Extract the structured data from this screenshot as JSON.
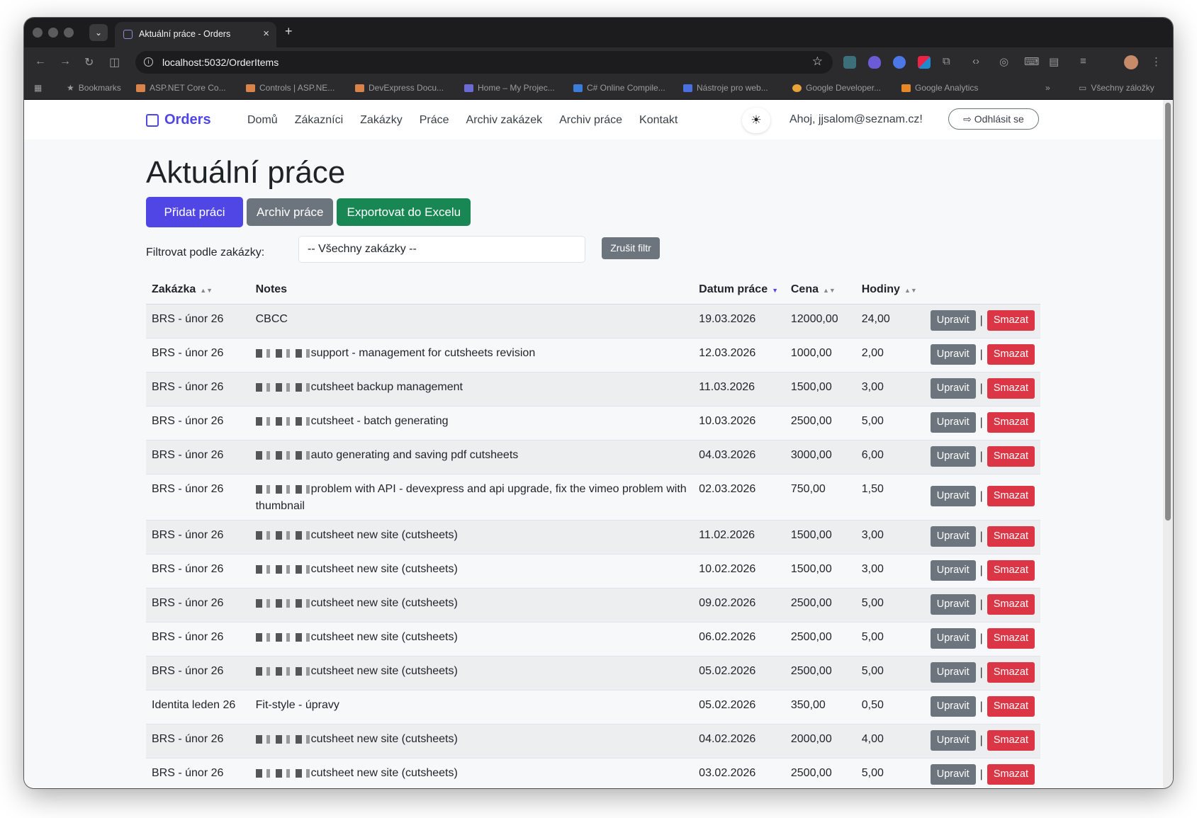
{
  "browser": {
    "tab_title": "Aktuální práce - Orders",
    "url": "localhost:5032/OrderItems",
    "bookmarks": [
      "Bookmarks",
      "ASP.NET Core Co...",
      "Controls | ASP.NE...",
      "DevExpress Docu...",
      "Home – My Projec...",
      "C# Online Compile...",
      "Nástroje pro web...",
      "Google Developer...",
      "Google Analytics"
    ],
    "bookmarks_overflow": "»",
    "all_bookmarks": "Všechny záložky"
  },
  "navbar": {
    "brand": "Orders",
    "links": [
      "Domů",
      "Zákazníci",
      "Zakázky",
      "Práce",
      "Archiv zakázek",
      "Archiv práce",
      "Kontakt"
    ],
    "greeting": "Ahoj, jjsalom@seznam.cz!",
    "logout": "Odhlásit se"
  },
  "page": {
    "title": "Aktuální práce",
    "add_button": "Přidat práci",
    "archive_button": "Archiv práce",
    "export_button": "Exportovat do Excelu",
    "filter_label": "Filtrovat podle zakázky:",
    "filter_value": "-- Všechny zakázky --",
    "reset_filter": "Zrušit filtr"
  },
  "table": {
    "headers": [
      "Zakázka",
      "Notes",
      "Datum práce",
      "Cena",
      "Hodiny"
    ],
    "edit_label": "Upravit",
    "delete_label": "Smazat",
    "separator": "|",
    "rows": [
      {
        "order": "BRS - únor 26",
        "redacted": false,
        "notes": "CBCC",
        "date": "19.03.2026",
        "price": "12000,00",
        "hours": "24,00"
      },
      {
        "order": "BRS - únor 26",
        "redacted": true,
        "notes": "support - management for cutsheets revision",
        "date": "12.03.2026",
        "price": "1000,00",
        "hours": "2,00"
      },
      {
        "order": "BRS - únor 26",
        "redacted": true,
        "notes": "cutsheet backup management",
        "date": "11.03.2026",
        "price": "1500,00",
        "hours": "3,00"
      },
      {
        "order": "BRS - únor 26",
        "redacted": true,
        "notes": "cutsheet - batch generating",
        "date": "10.03.2026",
        "price": "2500,00",
        "hours": "5,00"
      },
      {
        "order": "BRS - únor 26",
        "redacted": true,
        "notes": "auto generating and saving pdf cutsheets",
        "date": "04.03.2026",
        "price": "3000,00",
        "hours": "6,00"
      },
      {
        "order": "BRS - únor 26",
        "redacted": true,
        "notes": "problem with API - devexpress and api upgrade, fix the vimeo problem with thumbnail",
        "date": "02.03.2026",
        "price": "750,00",
        "hours": "1,50"
      },
      {
        "order": "BRS - únor 26",
        "redacted": true,
        "notes": "cutsheet new site (cutsheets)",
        "date": "11.02.2026",
        "price": "1500,00",
        "hours": "3,00"
      },
      {
        "order": "BRS - únor 26",
        "redacted": true,
        "notes": "cutsheet new site (cutsheets)",
        "date": "10.02.2026",
        "price": "1500,00",
        "hours": "3,00"
      },
      {
        "order": "BRS - únor 26",
        "redacted": true,
        "notes": "cutsheet new site (cutsheets)",
        "date": "09.02.2026",
        "price": "2500,00",
        "hours": "5,00"
      },
      {
        "order": "BRS - únor 26",
        "redacted": true,
        "notes": "cutsheet new site (cutsheets)",
        "date": "06.02.2026",
        "price": "2500,00",
        "hours": "5,00"
      },
      {
        "order": "BRS - únor 26",
        "redacted": true,
        "notes": "cutsheet new site (cutsheets)",
        "date": "05.02.2026",
        "price": "2500,00",
        "hours": "5,00"
      },
      {
        "order": "Identita leden 26",
        "redacted": false,
        "notes": "Fit-style - úpravy",
        "date": "05.02.2026",
        "price": "350,00",
        "hours": "0,50"
      },
      {
        "order": "BRS - únor 26",
        "redacted": true,
        "notes": "cutsheet new site (cutsheets)",
        "date": "04.02.2026",
        "price": "2000,00",
        "hours": "4,00"
      },
      {
        "order": "BRS - únor 26",
        "redacted": true,
        "notes": "cutsheet new site (cutsheets)",
        "date": "03.02.2026",
        "price": "2500,00",
        "hours": "5,00"
      }
    ]
  },
  "colors": {
    "brand": "#4f46e5",
    "secondary": "#6c757d",
    "success": "#198754",
    "danger": "#dc3545"
  }
}
